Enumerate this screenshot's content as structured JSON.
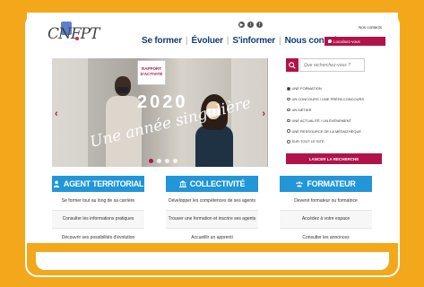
{
  "header": {
    "logo_text": "CNFPT",
    "social": [
      "▶",
      "t",
      "f"
    ],
    "top_link": "Nos contacts",
    "nav": [
      "Se former",
      "Évoluer",
      "S'informer",
      "Nous connaître"
    ],
    "locate_label": "Localisez-vous"
  },
  "hero": {
    "badge_line1": "RAPPORT",
    "badge_line2": "D'ACTIVITÉ",
    "year": "2020",
    "tagline": "Une année singulière",
    "prev_arrow": "‹",
    "next_arrow": "›",
    "slide_count": 4,
    "active_slide": 0
  },
  "search": {
    "placeholder": "Que recherchez-vous ?",
    "options": [
      "UNE FORMATION",
      "UN CONCOURS / UNE PRÉPA CONCOURS",
      "UN MÉTIER",
      "UNE ACTUALITÉ / UN ÉVÉNEMENT",
      "UNE RESSOURCE DE LA MÉDIATHÈQUE",
      "SUR TOUT LE SITE"
    ],
    "selected_index": 0,
    "launch_label": "LANCER LA RECHERCHE"
  },
  "cards": [
    {
      "title": "AGENT TERRITORIAL",
      "icon": "person-icon",
      "links": [
        "Se former tout au long de sa carrière",
        "Consulter les informations pratiques",
        "Découvrir ses possibilités d'évolution"
      ]
    },
    {
      "title": "COLLECTIVITÉ",
      "icon": "building-icon",
      "links": [
        "Développer les compétences de ses agents",
        "Trouver une formation et inscrire ses agents",
        "Accueillir un apprenti"
      ]
    },
    {
      "title": "FORMATEUR",
      "icon": "group-icon",
      "links": [
        "Devenir formateur ou formatrice",
        "Accédez à votre espace",
        "Consulter les annonces"
      ]
    }
  ],
  "colors": {
    "accent": "#b0134a",
    "brand_blue": "#2196d8",
    "nav_blue": "#143c78",
    "background": "#f3a81c"
  }
}
